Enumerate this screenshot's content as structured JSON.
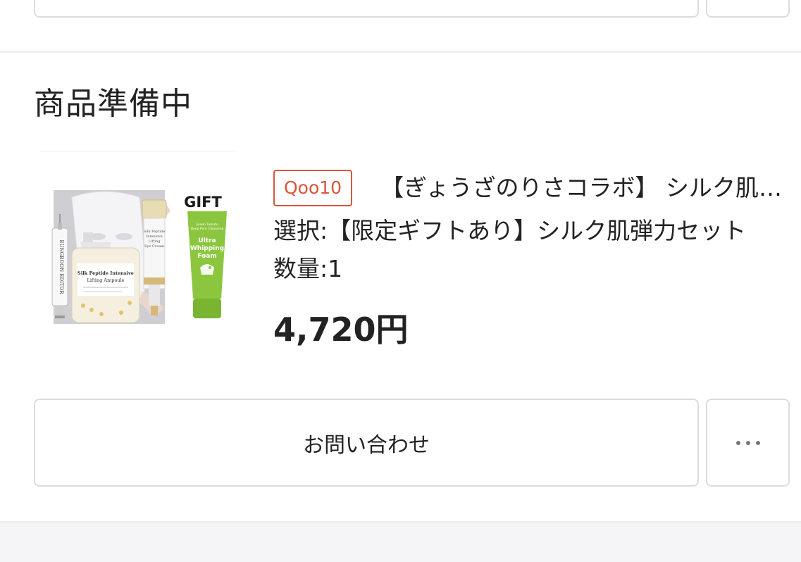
{
  "order_section": {
    "status_title": "商品準備中",
    "item": {
      "shop_badge": "Qoo10",
      "product_name": "【ぎょうざのりさコラボ】 シルク肌弾力セット",
      "option_label": "選択:",
      "option_value": "【限定ギフトあり】シルク肌弾力セット",
      "quantity_label": "数量:",
      "quantity_value": "1",
      "price": "4,720円",
      "thumbnail": {
        "gift_label": "GIFT",
        "ampoule_label": "Silk Peptide Intensive Lifting Ampoule",
        "eye_cream_label": "Silk Peptide Intensive Lifting Eye Cream",
        "foam_label": "Ultra Whipping Foam",
        "syringe_label": "EUNGBOON EDITOR"
      }
    },
    "actions": {
      "inquiry_label": "お問い合わせ",
      "more_icon": "more-horizontal-icon"
    }
  },
  "colors": {
    "badge_accent": "#d9553b",
    "foam_green": "#8cc63f",
    "border": "#dcdcdc"
  }
}
